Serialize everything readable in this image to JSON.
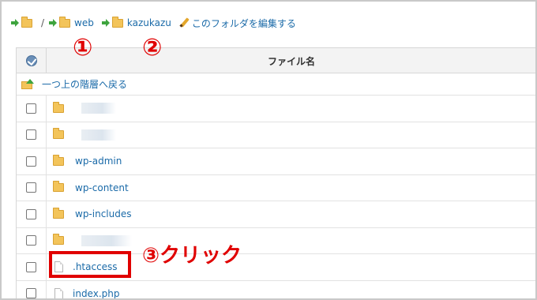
{
  "breadcrumb": {
    "separator": "/",
    "items": [
      {
        "label": "web"
      },
      {
        "label": "kazukazu"
      }
    ],
    "edit_label": "このフォルダを編集する"
  },
  "table": {
    "header": {
      "name_label": "ファイル名"
    },
    "up_label": "一つ上の階層へ戻る",
    "rows": [
      {
        "type": "folder",
        "name": ""
      },
      {
        "type": "folder",
        "name": ""
      },
      {
        "type": "folder",
        "name": "wp-admin"
      },
      {
        "type": "folder",
        "name": "wp-content"
      },
      {
        "type": "folder",
        "name": "wp-includes"
      },
      {
        "type": "folder",
        "name": ""
      },
      {
        "type": "file",
        "name": ".htaccess"
      },
      {
        "type": "file",
        "name": "index.php"
      }
    ]
  },
  "annotations": {
    "step1": "①",
    "step2": "②",
    "step3": "③クリック"
  },
  "colors": {
    "link": "#1a6aa8",
    "annotation": "#e00000",
    "folder": "#f3c45a",
    "arrow": "#3ea43e"
  }
}
